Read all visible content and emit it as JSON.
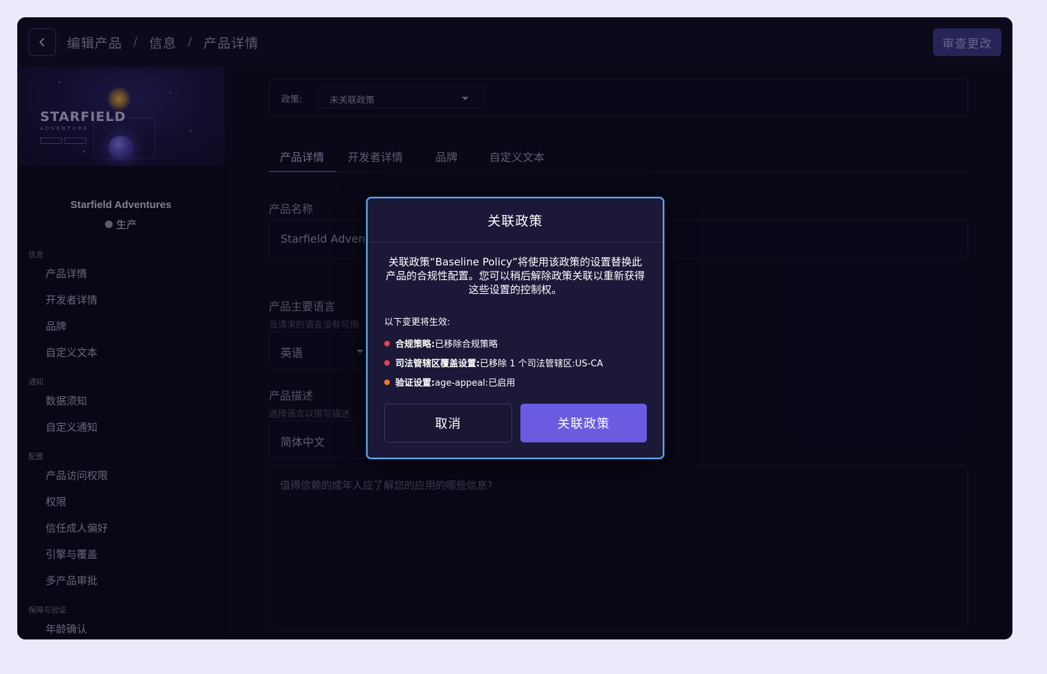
{
  "header": {
    "breadcrumb": [
      "编辑产品",
      "信息",
      "产品详情"
    ],
    "breadcrumb_sep": "/",
    "review_button": "审查更改"
  },
  "sidebar": {
    "hero": {
      "brand": "STARFIELD",
      "subtitle": "ADVENTURE"
    },
    "product_name": "Starfield Adventures",
    "product_status": "生产",
    "sections": [
      {
        "title": "信息",
        "items": [
          "产品详情",
          "开发者详情",
          "品牌",
          "自定义文本"
        ]
      },
      {
        "title": "通知",
        "items": [
          "数据须知",
          "自定义通知"
        ]
      },
      {
        "title": "配置",
        "items": [
          "产品访问权限",
          "权限",
          "信任成人偏好",
          "引擎与覆盖",
          "多产品审批"
        ]
      },
      {
        "title": "保障与验证",
        "items": [
          "年龄确认"
        ]
      }
    ]
  },
  "main": {
    "policy": {
      "label": "政策:",
      "value": "未关联政策"
    },
    "tabs": [
      "产品详情",
      "开发者详情",
      "品牌",
      "自定义文本"
    ],
    "product_name": {
      "label": "产品名称",
      "value": "Starfield Adventu"
    },
    "primary_language": {
      "label": "产品主要语言",
      "hint": "当请求的语言没有可用",
      "value": "英语"
    },
    "description": {
      "label": "产品描述",
      "hint": "选择语言以撰写描述",
      "language": "简体中文",
      "placeholder": "值得信赖的成年人应了解您的应用的哪些信息?"
    }
  },
  "modal": {
    "title": "关联政策",
    "body": "关联政策“Baseline Policy”将使用该政策的设置替换此产品的合规性配置。您可以稍后解除政策关联以重新获得这些设置的控制权。",
    "changes_title": "以下变更将生效:",
    "changes": [
      {
        "label": "合规策略:",
        "value": "已移除合规策略",
        "color": "#e0454f"
      },
      {
        "label": "司法管辖区覆盖设置:",
        "value": "已移除 1 个司法管辖区:US-CA",
        "color": "#e0454f"
      },
      {
        "label": "验证设置:",
        "value": "age-appeal:已启用",
        "color": "#f07a1f"
      }
    ],
    "cancel_button": "取消",
    "confirm_button": "关联政策"
  },
  "colors": {
    "accent": "#6b5be0",
    "modal_border": "#5fa8f0",
    "background": "#0e0a1e"
  }
}
